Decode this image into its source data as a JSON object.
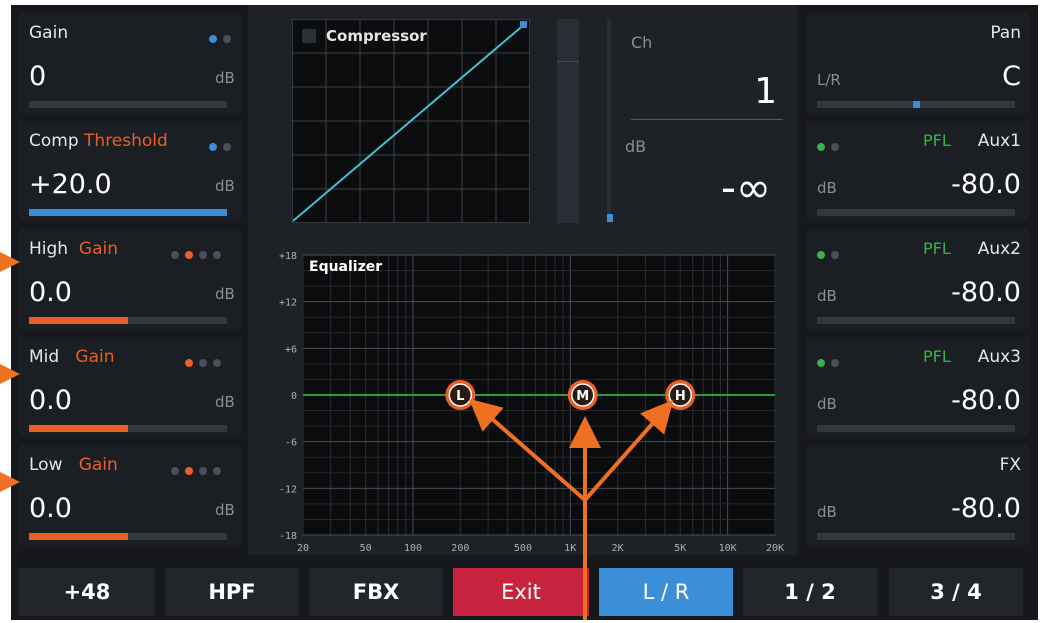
{
  "left": {
    "gain": {
      "label": "Gain",
      "value": "0",
      "unit": "dB"
    },
    "comp": {
      "label": "Comp",
      "sub": "Threshold",
      "value": "+20.0",
      "unit": "dB"
    },
    "high": {
      "label": "High",
      "sub": "Gain",
      "value": "0.0",
      "unit": "dB"
    },
    "mid": {
      "label": "Mid",
      "sub": "Gain",
      "value": "0.0",
      "unit": "dB"
    },
    "low": {
      "label": "Low",
      "sub": "Gain",
      "value": "0.0",
      "unit": "dB"
    }
  },
  "compressor": {
    "label": "Compressor"
  },
  "channel": {
    "ch_label": "Ch",
    "ch_value": "1",
    "db_label": "dB",
    "db_value": "-∞"
  },
  "eq": {
    "title": "Equalizer",
    "y_ticks": [
      "+18",
      "+12",
      "+6",
      "0",
      "-6",
      "-12",
      "-18"
    ],
    "x_ticks": [
      "20",
      "50",
      "100",
      "200",
      "500",
      "1K",
      "2K",
      "5K",
      "10K",
      "20K"
    ],
    "bands": [
      {
        "key": "L",
        "freq_hz": 200,
        "gain_db": 0
      },
      {
        "key": "M",
        "freq_hz": 1200,
        "gain_db": 0
      },
      {
        "key": "H",
        "freq_hz": 5000,
        "gain_db": 0
      }
    ]
  },
  "right": {
    "pan": {
      "label": "Pan",
      "lr": "L/R",
      "value": "C"
    },
    "aux1": {
      "pfl": "PFL",
      "label": "Aux1",
      "unit": "dB",
      "value": "-80.0"
    },
    "aux2": {
      "pfl": "PFL",
      "label": "Aux2",
      "unit": "dB",
      "value": "-80.0"
    },
    "aux3": {
      "pfl": "PFL",
      "label": "Aux3",
      "unit": "dB",
      "value": "-80.0"
    },
    "fx": {
      "label": "FX",
      "unit": "dB",
      "value": "-80.0"
    }
  },
  "buttons": {
    "b48": "+48",
    "hpf": "HPF",
    "fbx": "FBX",
    "exit": "Exit",
    "lr": "L / R",
    "b12": "1 / 2",
    "b34": "3 / 4"
  },
  "colors": {
    "accent_blue": "#3b8fd6",
    "accent_orange": "#ea5f25",
    "exit_red": "#c8233e",
    "pfl_green": "#3ab14a"
  },
  "levels": {
    "comp_threshold_fill": 1.0,
    "high_gain_fill": 0.5,
    "mid_gain_fill": 0.5,
    "low_gain_fill": 0.5,
    "pan_position": 0.5
  }
}
